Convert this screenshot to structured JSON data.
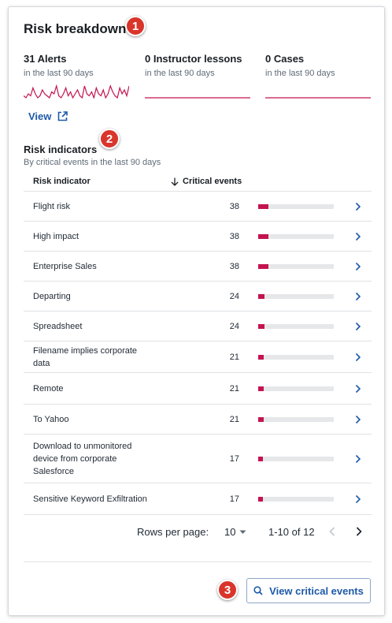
{
  "header": {
    "title": "Risk breakdown"
  },
  "callouts": [
    "1",
    "2",
    "3"
  ],
  "stats": [
    {
      "count_label": "31 Alerts",
      "period": "in the last 90 days",
      "activity": [
        1,
        0,
        2,
        1,
        5,
        2,
        0,
        1,
        4,
        2,
        1,
        0,
        3,
        2,
        6,
        1,
        0,
        2,
        5,
        1,
        3,
        0,
        2,
        4,
        1,
        0,
        6,
        2,
        1,
        3,
        0,
        5,
        2,
        1,
        4,
        0,
        2,
        6,
        3,
        1,
        0,
        5,
        2,
        4,
        1,
        6
      ]
    },
    {
      "count_label": "0 Instructor lessons",
      "period": "in the last 90 days",
      "activity": []
    },
    {
      "count_label": "0 Cases",
      "period": "in the last 90 days",
      "activity": []
    }
  ],
  "view_link": {
    "label": "View"
  },
  "risk_indicators": {
    "title": "Risk indicators",
    "subtitle": "By critical events in the last 90 days",
    "columns": {
      "indicator": "Risk indicator",
      "events": "Critical events"
    },
    "max_scale": 280,
    "rows": [
      {
        "name": "Flight risk",
        "events": "38"
      },
      {
        "name": "High impact",
        "events": "38"
      },
      {
        "name": "Enterprise Sales",
        "events": "38"
      },
      {
        "name": "Departing",
        "events": "24"
      },
      {
        "name": "Spreadsheet",
        "events": "24"
      },
      {
        "name": "Filename implies corporate data",
        "events": "21"
      },
      {
        "name": "Remote",
        "events": "21"
      },
      {
        "name": "To Yahoo",
        "events": "21"
      },
      {
        "name": "Download to unmonitored device from corporate Salesforce",
        "events": "17"
      },
      {
        "name": "Sensitive Keyword Exfiltration",
        "events": "17"
      }
    ]
  },
  "pagination": {
    "rows_per_page_label": "Rows per page:",
    "rows_per_page_value": "10",
    "range": "1-10 of 12"
  },
  "footer": {
    "button_label": "View critical events"
  },
  "colors": {
    "accent": "#c4134f",
    "link": "#1e5aa8",
    "callout": "#d9352b"
  }
}
